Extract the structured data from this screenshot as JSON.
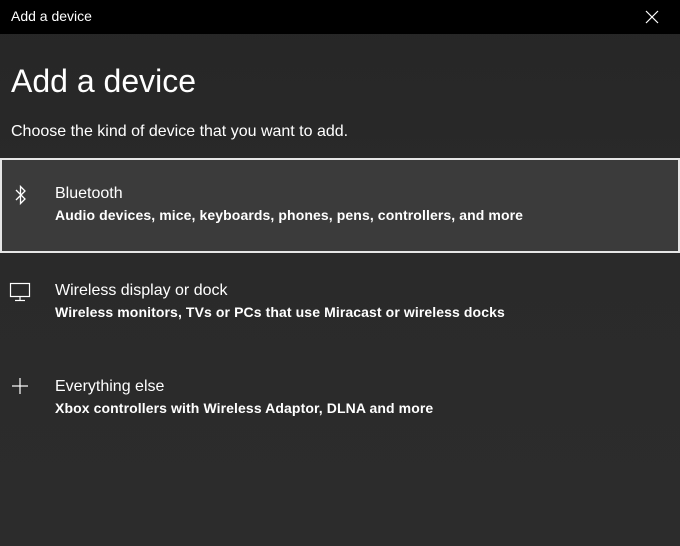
{
  "window": {
    "title": "Add a device"
  },
  "header": {
    "title": "Add a device",
    "subtitle": "Choose the kind of device that you want to add."
  },
  "options": [
    {
      "title": "Bluetooth",
      "description": "Audio devices, mice, keyboards, phones, pens, controllers, and more",
      "icon": "bluetooth-icon",
      "selected": true
    },
    {
      "title": "Wireless display or dock",
      "description": "Wireless monitors, TVs or PCs that use Miracast or wireless docks",
      "icon": "monitor-icon",
      "selected": false
    },
    {
      "title": "Everything else",
      "description": "Xbox controllers with Wireless Adaptor, DLNA and more",
      "icon": "plus-icon",
      "selected": false
    }
  ],
  "colors": {
    "titlebar": "#000000",
    "background": "#2b2b2b",
    "selected_background": "#3b3b3b",
    "selected_border": "#e6e6e6",
    "text": "#ffffff"
  }
}
